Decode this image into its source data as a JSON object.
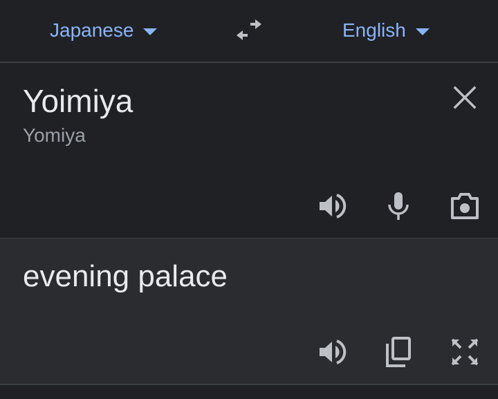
{
  "language_bar": {
    "source_language": "Japanese",
    "target_language": "English",
    "swap_icon": "swap-arrows-icon"
  },
  "source": {
    "text": "Yoimiya",
    "romanization": "Yomiya",
    "icons": [
      "close-icon",
      "speaker-icon",
      "microphone-icon",
      "camera-icon"
    ]
  },
  "result": {
    "text": "evening palace",
    "icons": [
      "speaker-icon",
      "copy-icon",
      "fullscreen-icon"
    ]
  },
  "colors": {
    "background": "#202124",
    "result_background": "#2b2c2f",
    "accent": "#8ab4f8",
    "text_primary": "#e8eaed",
    "text_secondary": "#9aa0a6",
    "icon": "#bdc1c6"
  }
}
